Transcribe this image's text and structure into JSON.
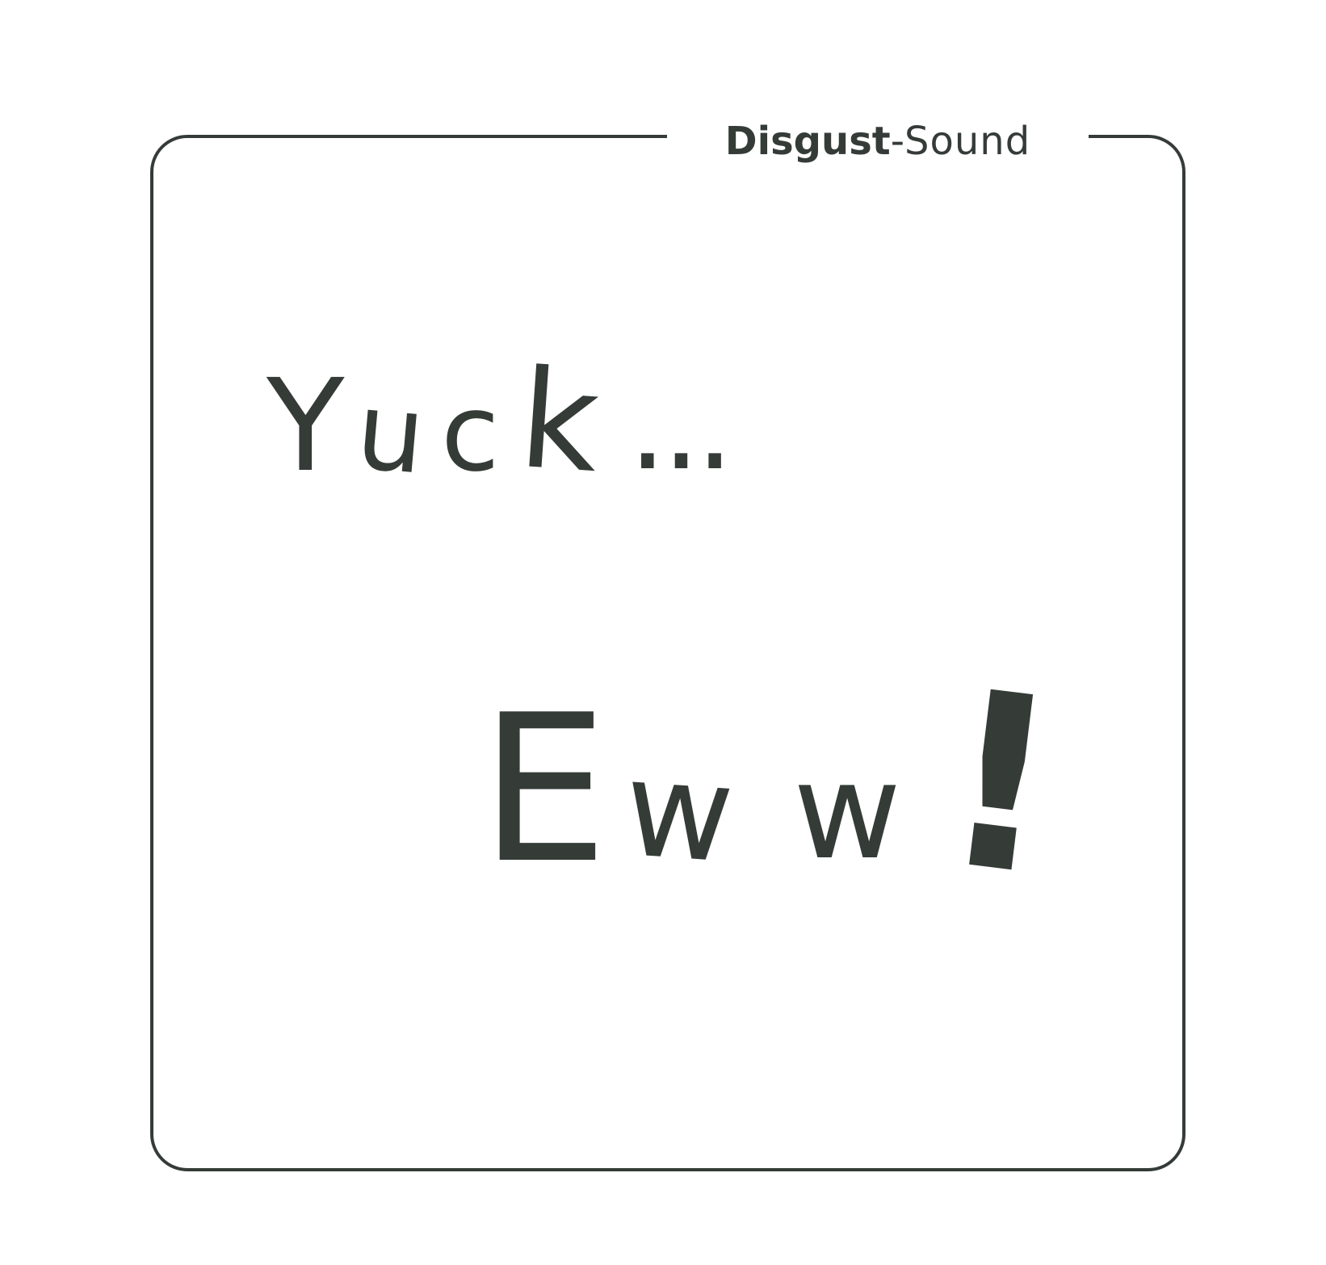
{
  "card": {
    "title_strong": "Disgust",
    "title_separator": " - ",
    "title_rest": "Sound"
  },
  "sound_words": [
    {
      "letters": [
        "Y",
        "u",
        "c",
        "k"
      ],
      "trailing": "..."
    },
    {
      "letters": [
        "E",
        "w",
        "w"
      ],
      "trailing": "!"
    }
  ],
  "colors": {
    "ink": "#353c38",
    "background": "#ffffff"
  }
}
